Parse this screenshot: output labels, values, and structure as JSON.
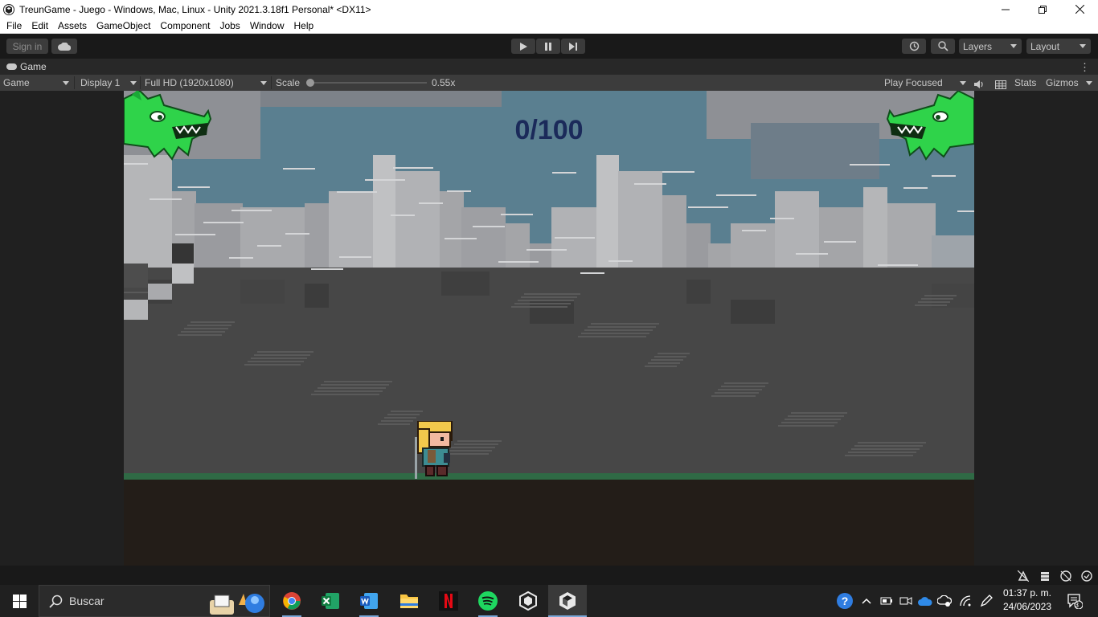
{
  "window": {
    "title": "TreunGame - Juego - Windows, Mac, Linux - Unity 2021.3.18f1 Personal* <DX11>"
  },
  "menu": [
    "File",
    "Edit",
    "Assets",
    "GameObject",
    "Component",
    "Jobs",
    "Window",
    "Help"
  ],
  "toolbar": {
    "signin_label": "Sign in",
    "layers_label": "Layers",
    "layout_label": "Layout"
  },
  "tab": {
    "label": "Game"
  },
  "gamebar": {
    "mode": "Game",
    "display": "Display 1",
    "resolution": "Full HD (1920x1080)",
    "scale_label": "Scale",
    "scale_value": "0.55x",
    "play_mode": "Play Focused",
    "stats_label": "Stats",
    "gizmos_label": "Gizmos"
  },
  "game": {
    "score": "0/100"
  },
  "taskbar": {
    "search_placeholder": "Buscar",
    "time": "01:37 p. m.",
    "date": "24/06/2023",
    "notification_count": "3"
  },
  "colors": {
    "sky": "#5a7f90",
    "score": "#1b2a5a",
    "ground": "#2f6a45",
    "dragon": "#2fd34a",
    "editor_bg": "#191919"
  }
}
